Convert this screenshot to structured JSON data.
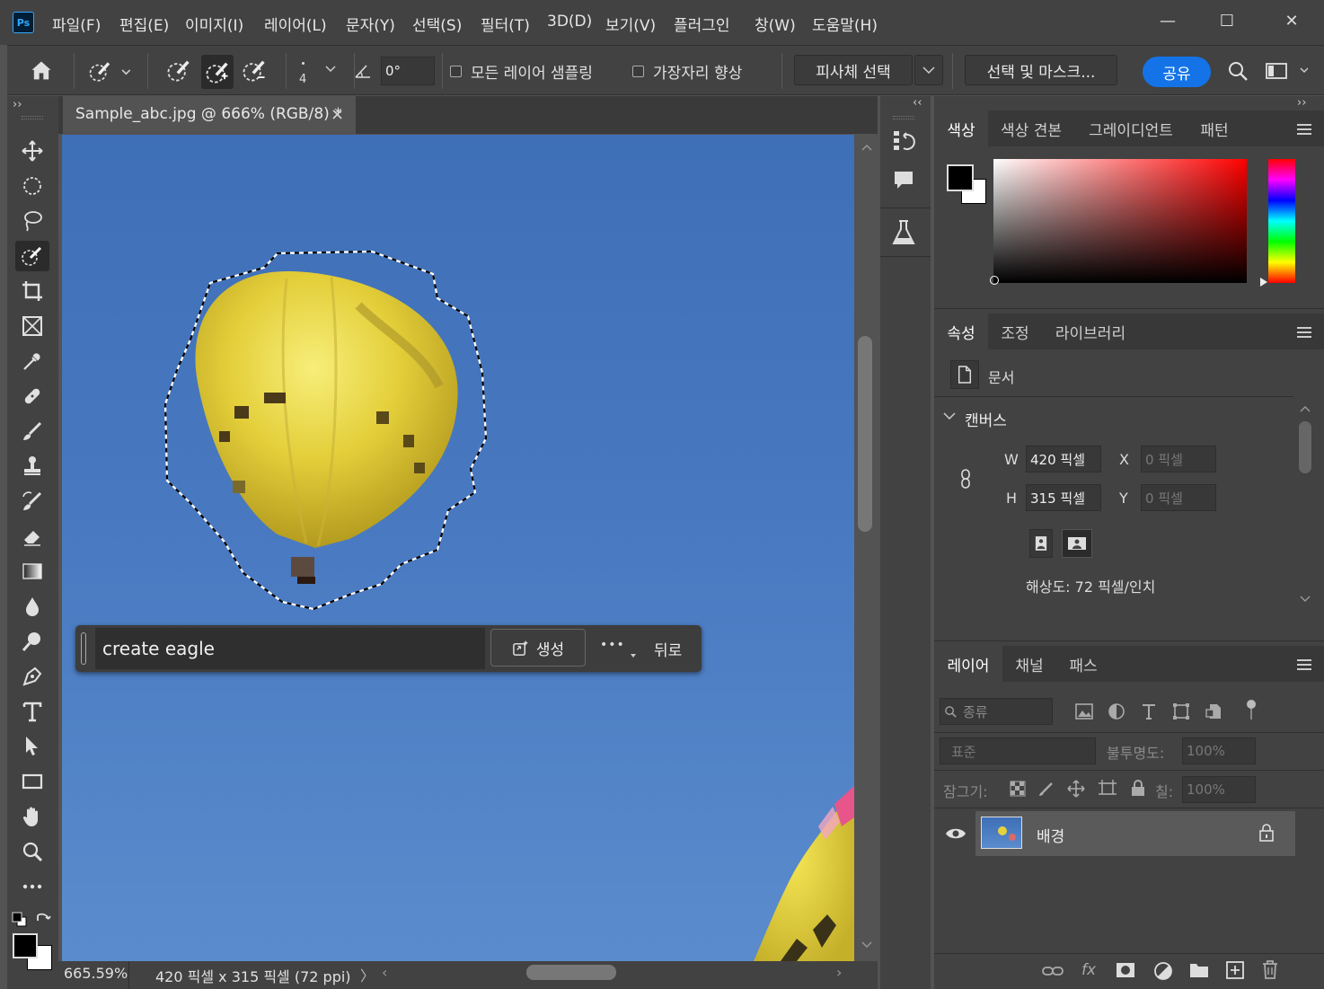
{
  "app": {
    "logo": "Ps",
    "menu": [
      "파일(F)",
      "편집(E)",
      "이미지(I)",
      "레이어(L)",
      "문자(Y)",
      "선택(S)",
      "필터(T)",
      "3D(D)",
      "보기(V)",
      "플러그인",
      "창(W)",
      "도움말(H)"
    ],
    "window_controls": {
      "minimize": "—",
      "maximize": "☐",
      "close": "✕"
    }
  },
  "options_bar": {
    "brush_size": "4",
    "angle_value": "0°",
    "sample_all_layers": "모든 레이어 샘플링",
    "enhance_edge": "가장자리 향상",
    "select_subject": "피사체 선택",
    "select_and_mask": "선택 및 마스크...",
    "share": "공유",
    "sample_all_layers_checked": false,
    "enhance_edge_checked": false
  },
  "document": {
    "tab_title": "Sample_abc.jpg @ 666% (RGB/8) *",
    "close_glyph": "×",
    "zoom": "665.59%",
    "doc_info": "420 픽셀 x 315 픽셀 (72 ppi)"
  },
  "contextual_task_bar": {
    "prompt_value": "create eagle",
    "generate": "생성",
    "more": "•••",
    "back": "뒤로"
  },
  "color_panel": {
    "tabs": [
      "색상",
      "색상 견본",
      "그레이디언트",
      "패턴"
    ],
    "foreground": "#000000",
    "background": "#ffffff",
    "hue_color": "#ff0000"
  },
  "properties_panel": {
    "tabs": [
      "속성",
      "조정",
      "라이브러리"
    ],
    "type_label": "문서",
    "section": "캔버스",
    "w_label": "W",
    "w_value": "420 픽셀",
    "h_label": "H",
    "h_value": "315 픽셀",
    "x_label": "X",
    "x_value": "0 픽셀",
    "y_label": "Y",
    "y_value": "0 픽셀",
    "resolution": "해상도: 72 픽셀/인치"
  },
  "layers_panel": {
    "tabs": [
      "레이어",
      "채널",
      "패스"
    ],
    "filter_kind": "종류",
    "blend_mode": "표준",
    "opacity_label": "불투명도:",
    "opacity_value": "100%",
    "lock_label": "잠그기:",
    "fill_label": "칠:",
    "fill_value": "100%",
    "layers": [
      {
        "name": "배경",
        "visible": true,
        "locked": true
      }
    ]
  }
}
